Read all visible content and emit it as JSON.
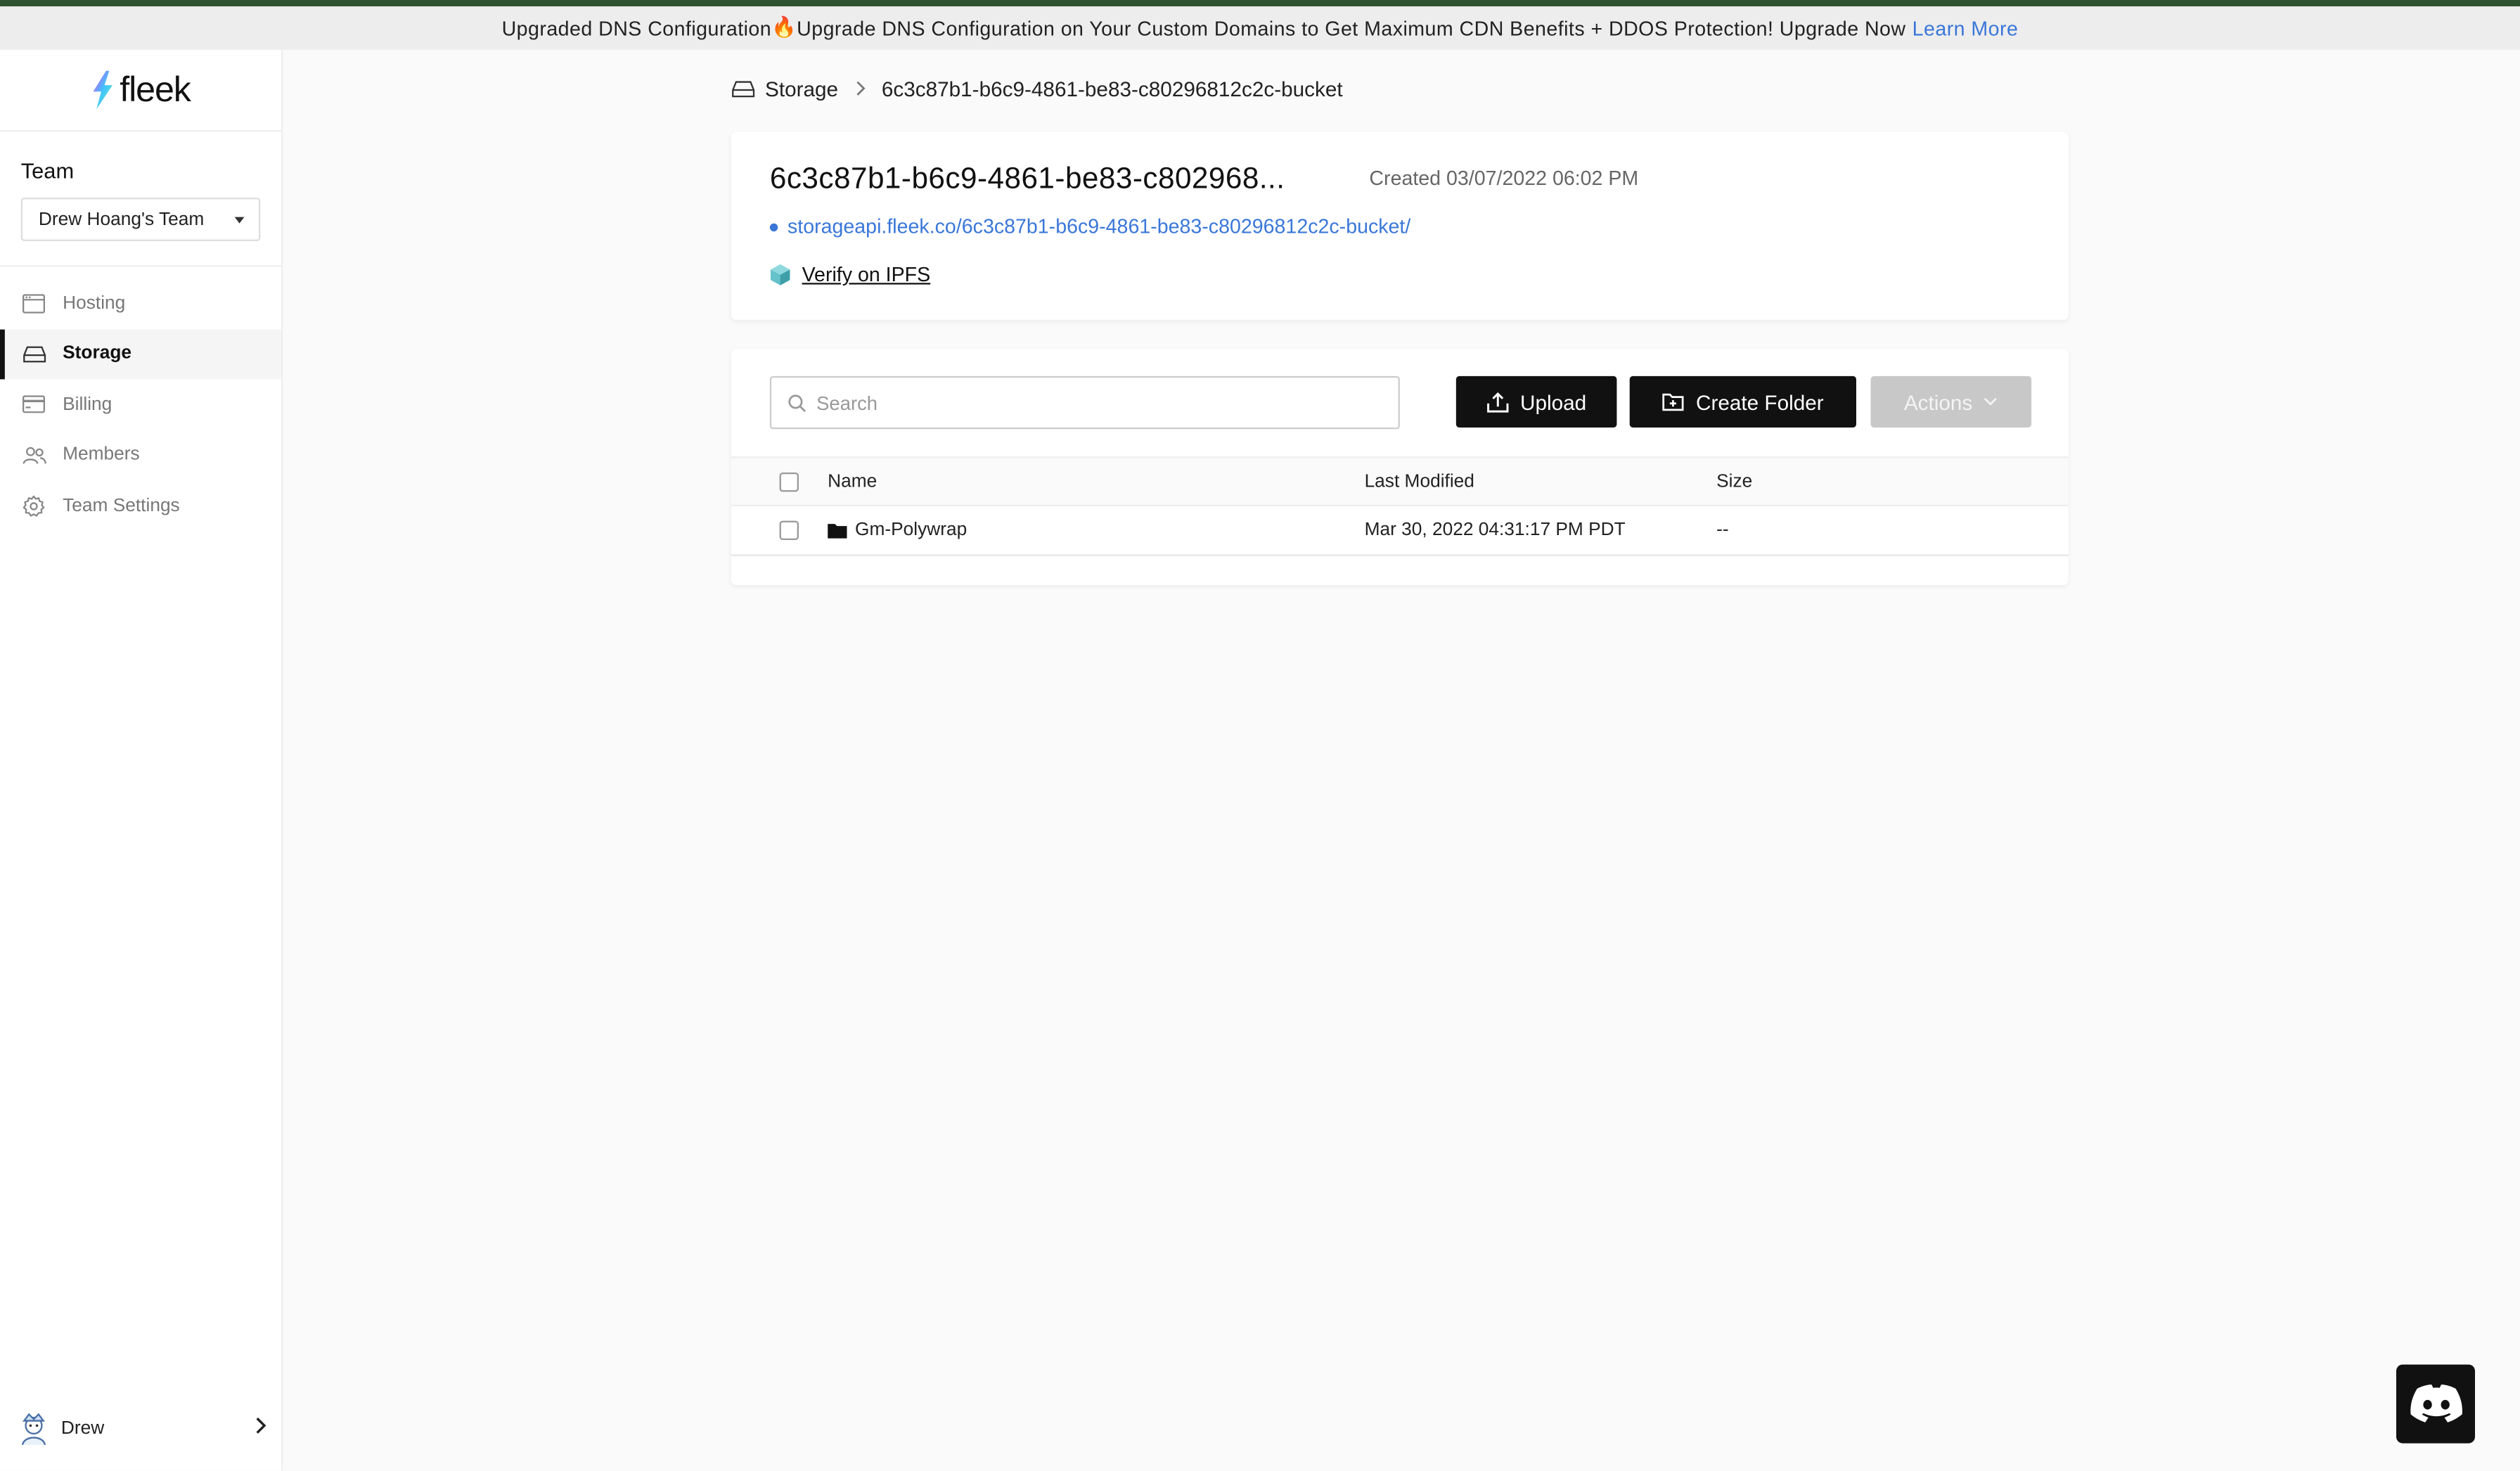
{
  "banner": {
    "text_before": "Upgraded DNS Configuration ",
    "fire_emoji": "🔥",
    "text_after": "Upgrade DNS Configuration on Your Custom Domains to Get Maximum CDN Benefits + DDOS Protection! Upgrade Now",
    "link_label": "Learn More",
    "link_color": "#3a77d8"
  },
  "sidebar": {
    "logo_text": "fleek",
    "team_label": "Team",
    "team_select_value": "Drew Hoang's Team",
    "items": [
      {
        "label": "Hosting",
        "icon": "hosting-icon",
        "active": false
      },
      {
        "label": "Storage",
        "icon": "storage-icon",
        "active": true
      },
      {
        "label": "Billing",
        "icon": "billing-icon",
        "active": false
      },
      {
        "label": "Members",
        "icon": "members-icon",
        "active": false
      },
      {
        "label": "Team Settings",
        "icon": "gear-icon",
        "active": false
      }
    ],
    "user_name": "Drew"
  },
  "breadcrumb": {
    "root": "Storage",
    "current": "6c3c87b1-b6c9-4861-be83-c80296812c2c-bucket"
  },
  "bucket": {
    "title": "6c3c87b1-b6c9-4861-be83-c802968...",
    "created": "Created 03/07/2022 06:02 PM",
    "api_url": "storageapi.fleek.co/6c3c87b1-b6c9-4861-be83-c80296812c2c-bucket/",
    "verify_label": "Verify on IPFS"
  },
  "files": {
    "search_placeholder": "Search",
    "upload_label": "Upload",
    "create_folder_label": "Create Folder",
    "actions_label": "Actions",
    "columns": {
      "name": "Name",
      "last_modified": "Last Modified",
      "size": "Size"
    },
    "rows": [
      {
        "name": "Gm-Polywrap",
        "last_modified": "Mar 30, 2022 04:31:17 PM PDT",
        "size": "--"
      }
    ]
  }
}
